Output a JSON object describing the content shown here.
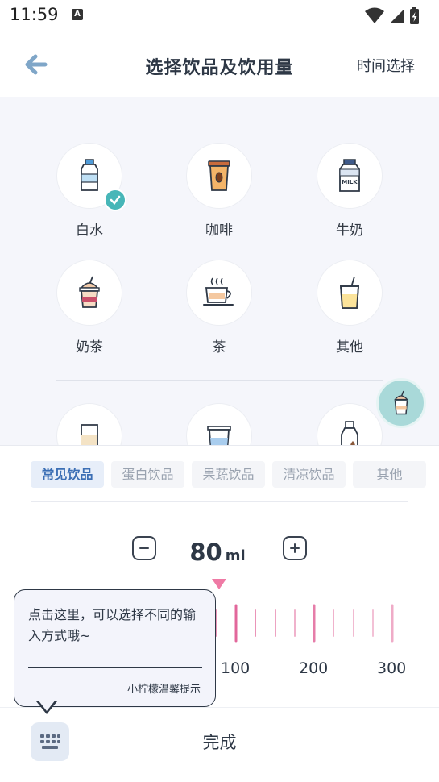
{
  "status_bar": {
    "time": "11:59",
    "notification_icon": "A",
    "icons": [
      "wifi-icon",
      "signal-icon",
      "battery-charging-icon"
    ]
  },
  "header": {
    "back_icon": "arrow-left-icon",
    "title": "选择饮品及饮用量",
    "time_select": "时间选择"
  },
  "drinks": [
    {
      "label": "白水",
      "icon": "water-bottle-icon",
      "selected": true
    },
    {
      "label": "咖啡",
      "icon": "coffee-cup-icon",
      "selected": false
    },
    {
      "label": "牛奶",
      "icon": "milk-bottle-icon",
      "selected": false
    },
    {
      "label": "奶茶",
      "icon": "milk-tea-icon",
      "selected": false
    },
    {
      "label": "茶",
      "icon": "tea-cup-icon",
      "selected": false
    },
    {
      "label": "其他",
      "icon": "juice-cup-icon",
      "selected": false
    }
  ],
  "drinks_partial_row": [
    "milk-carton-icon",
    "glass-icon",
    "bottle-icon"
  ],
  "milk_text": "MILK",
  "float_button_icon": "milk-tea-icon",
  "category_tabs": [
    {
      "label": "常见饮品",
      "active": true
    },
    {
      "label": "蛋白饮品",
      "active": false
    },
    {
      "label": "果蔬饮品",
      "active": false
    },
    {
      "label": "清凉饮品",
      "active": false
    },
    {
      "label": "其他",
      "active": false
    }
  ],
  "amount": {
    "value": "80",
    "unit": "ml"
  },
  "ruler": {
    "labels": [
      "100",
      "200",
      "300"
    ],
    "accent_color": "#e2679b",
    "marker_color": "#ef7aa5"
  },
  "tooltip": {
    "text": "点击这里，可以选择不同的输入方式哦~",
    "signature": "小柠檬温馨提示"
  },
  "footer": {
    "keyboard_icon": "keyboard-icon",
    "done_label": "完成"
  },
  "colors": {
    "accent": "#47b6b8",
    "title": "#2e3846",
    "active_tab": "#3c6fb5"
  }
}
